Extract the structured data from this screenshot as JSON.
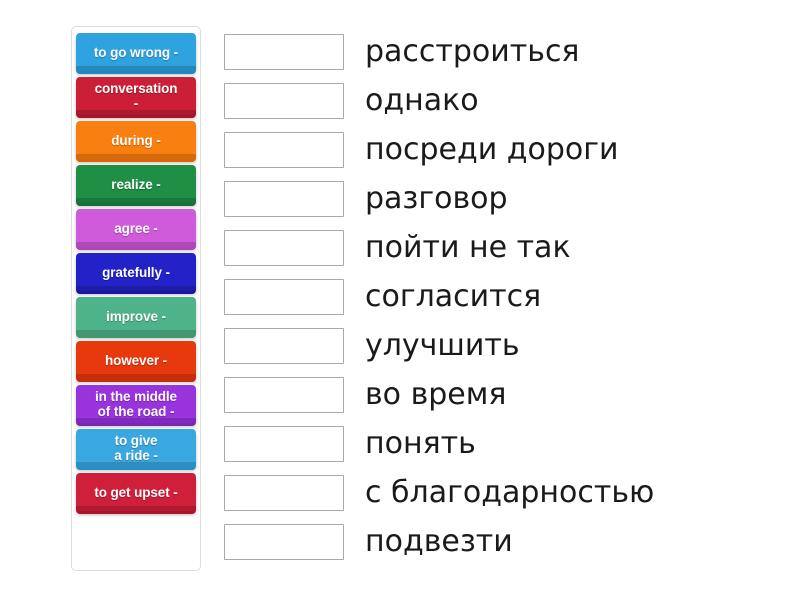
{
  "exercise": {
    "type": "match-up",
    "tiles": [
      {
        "label": "to go wrong -",
        "color": "#2fa3e0",
        "shade": "#1b88c4"
      },
      {
        "label": "conversation\n-",
        "color": "#cc1f37",
        "shade": "#a9142a"
      },
      {
        "label": "during -",
        "color": "#f98010",
        "shade": "#da6605"
      },
      {
        "label": "realize -",
        "color": "#1e8f45",
        "shade": "#15703a"
      },
      {
        "label": "agree -",
        "color": "#cf5ada",
        "shade": "#b243c0"
      },
      {
        "label": "gratefully -",
        "color": "#2222c8",
        "shade": "#1717a3"
      },
      {
        "label": "improve -",
        "color": "#4fb389",
        "shade": "#3a9a72"
      },
      {
        "label": "however -",
        "color": "#e8380d",
        "shade": "#c52c07"
      },
      {
        "label": "in the middle\nof the road -",
        "color": "#9933dd",
        "shade": "#7d23bb"
      },
      {
        "label": "to give\na ride -",
        "color": "#3aa8e0",
        "shade": "#2390c8"
      },
      {
        "label": "to get upset -",
        "color": "#d01f3a",
        "shade": "#ad142c"
      }
    ],
    "answers": [
      {
        "drop_value": "",
        "text": "расстроиться"
      },
      {
        "drop_value": "",
        "text": "однако"
      },
      {
        "drop_value": "",
        "text": "посреди дороги"
      },
      {
        "drop_value": "",
        "text": "разговор"
      },
      {
        "drop_value": "",
        "text": "пойти не так"
      },
      {
        "drop_value": "",
        "text": "согласится"
      },
      {
        "drop_value": "",
        "text": "улучшить"
      },
      {
        "drop_value": "",
        "text": "во время"
      },
      {
        "drop_value": "",
        "text": "понять"
      },
      {
        "drop_value": "",
        "text": "с благодарностью"
      },
      {
        "drop_value": "",
        "text": "подвезти"
      }
    ]
  }
}
